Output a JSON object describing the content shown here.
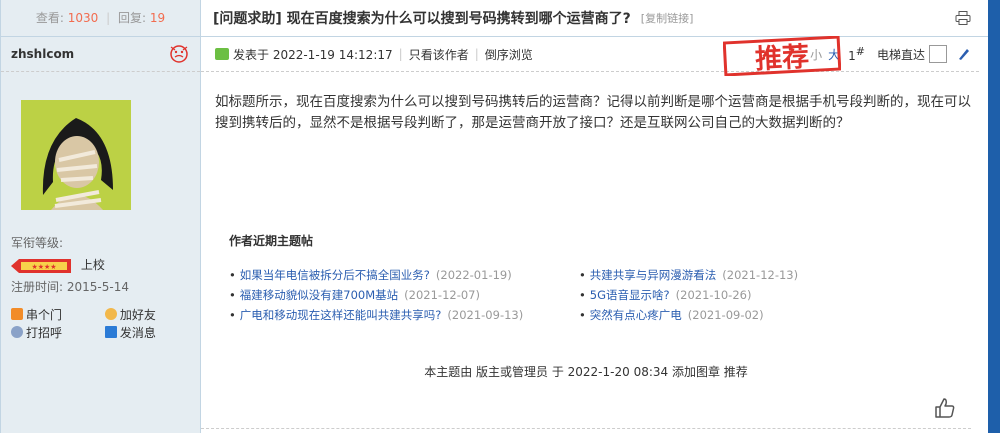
{
  "sidebar": {
    "view_label": "查看:",
    "view_count": "1030",
    "reply_label": "回复:",
    "reply_count": "19",
    "username": "zhshlcom",
    "rank_label": "军衔等级:",
    "rank_name": "上校",
    "register_label": "注册时间:",
    "register_date": "2015-5-14",
    "actions": {
      "visit": "串个门",
      "add_friend": "加好友",
      "greet": "打招呼",
      "message": "发消息"
    },
    "colors": {
      "accent_number": "#f26c4f",
      "background": "#e5edf2"
    }
  },
  "thread": {
    "title": "[问题求助] 现在百度搜索为什么可以搜到号码携转到哪个运营商了?",
    "copy_link": "[复制链接]",
    "posted_at": "发表于 2022-1-19 14:12:17",
    "only_author": "只看该作者",
    "reverse_order": "倒序浏览",
    "font_small": "小",
    "font_big": "大",
    "floor": "1",
    "floor_suffix": "#",
    "jump_label": "电梯直达",
    "stamp_text": "推荐",
    "body": "如标题所示，现在百度搜索为什么可以搜到号码携转后的运营商？记得以前判断是哪个运营商是根据手机号段判断的，现在可以搜到携转后的，显然不是根据号段判断了，那是运营商开放了接口？还是互联网公司自己的大数据判断的？",
    "recent_title": "作者近期主题帖",
    "recent_posts": [
      {
        "title": "如果当年电信被拆分后不搞全国业务?",
        "date": "(2022-01-19)"
      },
      {
        "title": "共建共享与异网漫游看法",
        "date": "(2021-12-13)"
      },
      {
        "title": "福建移动貌似没有建700M基站",
        "date": "(2021-12-07)"
      },
      {
        "title": "5G语音显示啥?",
        "date": "(2021-10-26)"
      },
      {
        "title": "广电和移动现在这样还能叫共建共享吗?",
        "date": "(2021-09-13)"
      },
      {
        "title": "突然有点心疼广电",
        "date": "(2021-09-02)"
      }
    ],
    "mod_note": "本主题由 版主或管理员 于 2022-1-20 08:34 添加图章 推荐",
    "colors": {
      "link": "#2b5eb0",
      "stamp": "#e0322c",
      "sidebar_accent": "#1e5faa"
    }
  }
}
